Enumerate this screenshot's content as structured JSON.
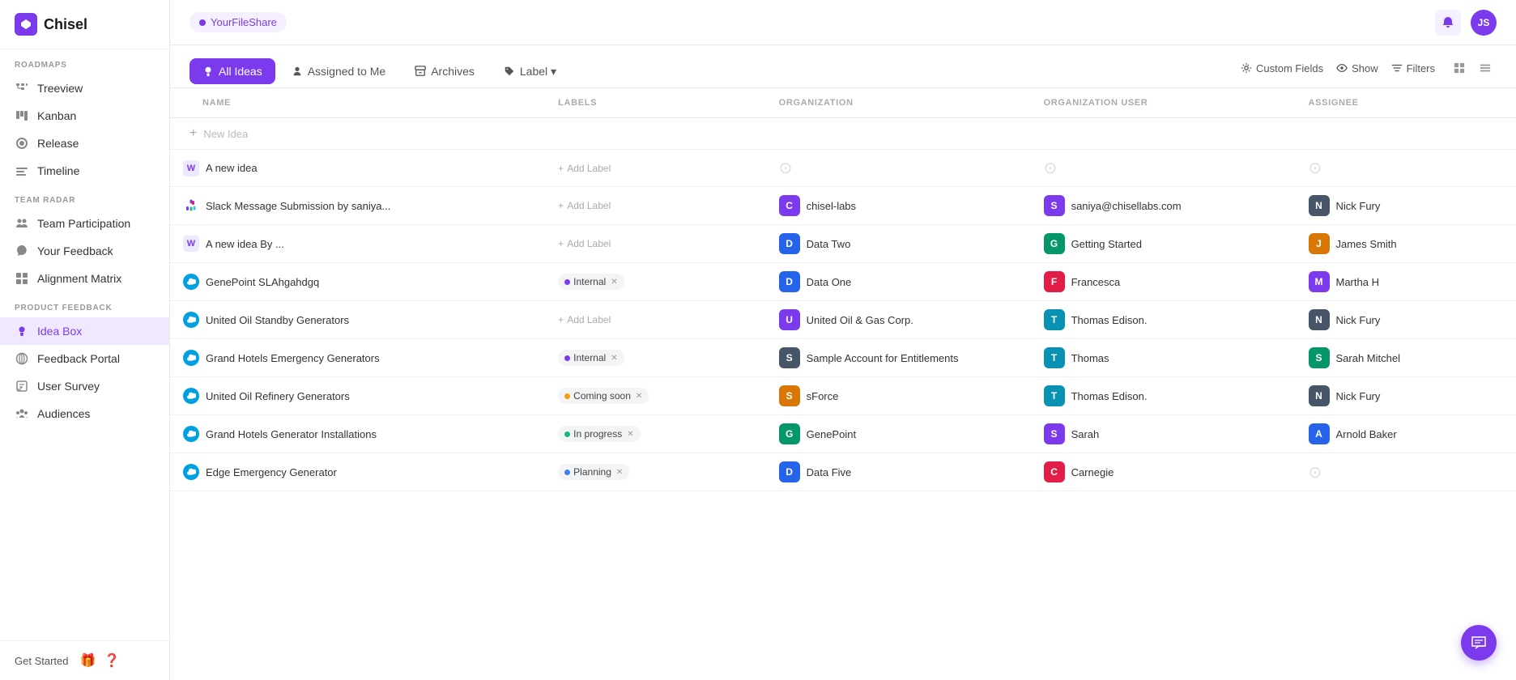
{
  "app": {
    "name": "Chisel"
  },
  "workspace": {
    "name": "YourFileShare"
  },
  "topBar": {
    "iconLabel": "JS"
  },
  "sidebar": {
    "sections": [
      {
        "label": "ROADMAPS",
        "items": [
          {
            "id": "treeview",
            "label": "Treeview",
            "icon": "tree"
          },
          {
            "id": "kanban",
            "label": "Kanban",
            "icon": "kanban"
          },
          {
            "id": "release",
            "label": "Release",
            "icon": "release"
          },
          {
            "id": "timeline",
            "label": "Timeline",
            "icon": "timeline"
          }
        ]
      },
      {
        "label": "TEAM RADAR",
        "items": [
          {
            "id": "team-participation",
            "label": "Team Participation",
            "icon": "team"
          },
          {
            "id": "your-feedback",
            "label": "Your Feedback",
            "icon": "feedback"
          },
          {
            "id": "alignment-matrix",
            "label": "Alignment Matrix",
            "icon": "matrix"
          }
        ]
      },
      {
        "label": "PRODUCT FEEDBACK",
        "items": [
          {
            "id": "idea-box",
            "label": "Idea Box",
            "icon": "idea",
            "active": true
          },
          {
            "id": "feedback-portal",
            "label": "Feedback Portal",
            "icon": "portal"
          },
          {
            "id": "user-survey",
            "label": "User Survey",
            "icon": "survey"
          },
          {
            "id": "audiences",
            "label": "Audiences",
            "icon": "audiences"
          }
        ]
      }
    ],
    "bottom": {
      "label": "Get Started"
    }
  },
  "tabs": {
    "items": [
      {
        "id": "all-ideas",
        "label": "All Ideas",
        "active": true,
        "icon": "💡"
      },
      {
        "id": "assigned-to-me",
        "label": "Assigned to Me",
        "active": false,
        "icon": "👤"
      },
      {
        "id": "archives",
        "label": "Archives",
        "active": false,
        "icon": "🗃"
      },
      {
        "id": "label",
        "label": "Label ▾",
        "active": false,
        "icon": "🏷"
      }
    ],
    "actions": {
      "customFields": "Custom Fields",
      "show": "Show",
      "filters": "Filters"
    }
  },
  "table": {
    "headers": {
      "name": "NAME",
      "labels": "LABELS",
      "organization": "ORGANIZATION",
      "orgUser": "ORGANIZATION USER",
      "assignee": "ASSIGNEE"
    },
    "newIdea": {
      "placeholder": "New Idea"
    },
    "rows": [
      {
        "id": 1,
        "iconType": "purple",
        "iconLabel": "W",
        "sourceType": "plain",
        "name": "A new idea",
        "labels": [],
        "addLabelText": "Add Label",
        "org": null,
        "orgUser": null,
        "assignee": null
      },
      {
        "id": 2,
        "iconType": "slack",
        "iconLabel": "S",
        "sourceType": "slack",
        "name": "Slack Message Submission by saniya...",
        "labels": [],
        "addLabelText": "Add Label",
        "org": {
          "letter": "C",
          "name": "chisel-labs",
          "color": "purple-bg"
        },
        "orgUser": {
          "letter": "S",
          "name": "saniya@chisellabs.com",
          "color": "purple-bg"
        },
        "assignee": {
          "letter": "N",
          "name": "Nick Fury",
          "color": "slate-bg"
        }
      },
      {
        "id": 3,
        "iconType": "purple",
        "iconLabel": "W",
        "sourceType": "plain",
        "name": "A new idea By ...",
        "labels": [],
        "addLabelText": "Add Label",
        "org": {
          "letter": "D",
          "name": "Data Two",
          "color": "blue-bg"
        },
        "orgUser": {
          "letter": "G",
          "name": "Getting Started",
          "color": "green-bg"
        },
        "assignee": {
          "letter": "J",
          "name": "James Smith",
          "color": "amber-bg"
        }
      },
      {
        "id": 4,
        "iconType": "crm",
        "iconLabel": "sf",
        "sourceType": "salesforce",
        "name": "GenePoint SLAhgahdgq",
        "labels": [
          {
            "text": "Internal",
            "dot": "internal"
          }
        ],
        "org": {
          "letter": "D",
          "name": "Data One",
          "color": "blue-bg"
        },
        "orgUser": {
          "letter": "F",
          "name": "Francesca",
          "color": "rose-bg"
        },
        "assignee": {
          "letter": "M",
          "name": "Martha H",
          "color": "purple-bg"
        }
      },
      {
        "id": 5,
        "iconType": "crm",
        "iconLabel": "sf",
        "sourceType": "salesforce",
        "name": "United Oil Standby Generators",
        "labels": [],
        "addLabelText": "Add Label",
        "org": {
          "letter": "U",
          "name": "United Oil & Gas Corp.",
          "color": "purple-bg"
        },
        "orgUser": {
          "letter": "T",
          "name": "Thomas Edison.",
          "color": "teal-bg"
        },
        "assignee": {
          "letter": "N",
          "name": "Nick Fury",
          "color": "slate-bg"
        }
      },
      {
        "id": 6,
        "iconType": "crm",
        "iconLabel": "sf",
        "sourceType": "salesforce",
        "name": "Grand Hotels Emergency Generators",
        "labels": [
          {
            "text": "Internal",
            "dot": "internal"
          }
        ],
        "org": {
          "letter": "S",
          "name": "Sample Account for Entitlements",
          "color": "slate-bg"
        },
        "orgUser": {
          "letter": "T",
          "name": "Thomas",
          "color": "teal-bg"
        },
        "assignee": {
          "letter": "S",
          "name": "Sarah Mitchel",
          "color": "green-bg"
        }
      },
      {
        "id": 7,
        "iconType": "crm",
        "iconLabel": "sf",
        "sourceType": "salesforce",
        "name": "United Oil Refinery Generators",
        "labels": [
          {
            "text": "Coming soon",
            "dot": "coming-soon"
          }
        ],
        "org": {
          "letter": "S",
          "name": "sForce",
          "color": "amber-bg"
        },
        "orgUser": {
          "letter": "T",
          "name": "Thomas Edison.",
          "color": "teal-bg"
        },
        "assignee": {
          "letter": "N",
          "name": "Nick Fury",
          "color": "slate-bg"
        }
      },
      {
        "id": 8,
        "iconType": "crm",
        "iconLabel": "sf",
        "sourceType": "salesforce",
        "name": "Grand Hotels Generator Installations",
        "labels": [
          {
            "text": "In progress",
            "dot": "in-progress"
          }
        ],
        "org": {
          "letter": "G",
          "name": "GenePoint",
          "color": "green-bg"
        },
        "orgUser": {
          "letter": "S",
          "name": "Sarah",
          "color": "purple-bg"
        },
        "assignee": {
          "letter": "A",
          "name": "Arnold Baker",
          "color": "blue-bg"
        }
      },
      {
        "id": 9,
        "iconType": "crm",
        "iconLabel": "sf",
        "sourceType": "salesforce",
        "name": "Edge Emergency Generator",
        "labels": [
          {
            "text": "Planning",
            "dot": "planning"
          }
        ],
        "org": {
          "letter": "D",
          "name": "Data Five",
          "color": "blue-bg"
        },
        "orgUser": {
          "letter": "C",
          "name": "Carnegie",
          "color": "rose-bg"
        },
        "assignee": null
      }
    ]
  }
}
